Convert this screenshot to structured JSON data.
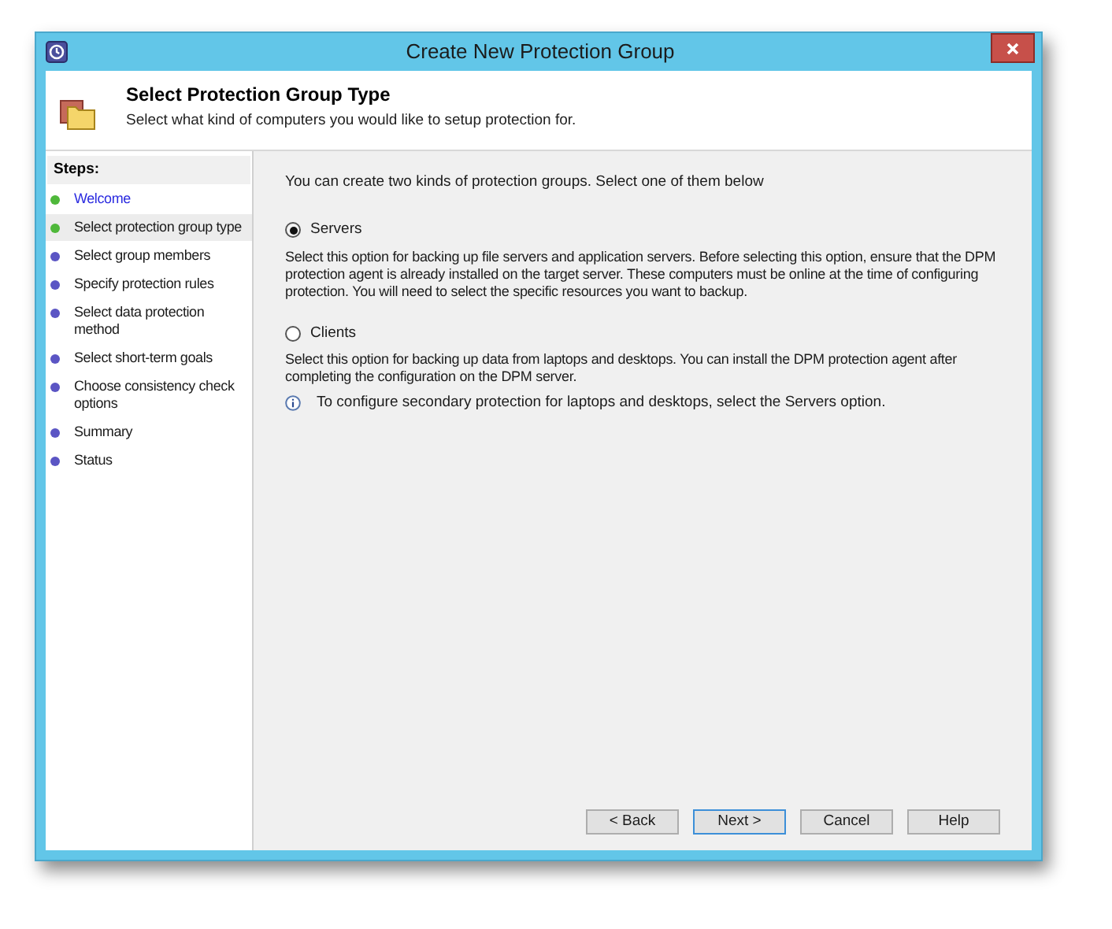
{
  "window": {
    "title": "Create New Protection Group"
  },
  "header": {
    "title": "Select Protection Group Type",
    "subtitle": "Select what kind of computers you would like to setup protection for."
  },
  "steps": {
    "heading": "Steps:",
    "items": [
      {
        "label": "Welcome",
        "completed": true,
        "selected": false
      },
      {
        "label": "Select protection group type",
        "completed": true,
        "selected": true
      },
      {
        "label": "Select group members",
        "completed": false,
        "selected": false
      },
      {
        "label": "Specify protection rules",
        "completed": false,
        "selected": false
      },
      {
        "label": "Select data protection method",
        "completed": false,
        "selected": false
      },
      {
        "label": "Select short-term goals",
        "completed": false,
        "selected": false
      },
      {
        "label": "Choose consistency check options",
        "completed": false,
        "selected": false
      },
      {
        "label": "Summary",
        "completed": false,
        "selected": false
      },
      {
        "label": "Status",
        "completed": false,
        "selected": false
      }
    ]
  },
  "intro": "You can create two kinds of protection groups. Select one of them below",
  "options": [
    {
      "label": "Servers",
      "selected": true,
      "description": "Select this option for backing up file servers and application servers. Before selecting this option, ensure that the DPM protection agent is already installed on the target server. These computers must be online at the time of configuring protection. You will need to select the specific resources you want to backup."
    },
    {
      "label": "Clients",
      "selected": false,
      "description": "Select this option for backing up data from laptops and desktops. You can install the DPM protection agent after completing the configuration on the DPM server.",
      "note": "To configure secondary protection for laptops and desktops, select the Servers option."
    }
  ],
  "buttons": [
    {
      "label": "< Back",
      "default": false
    },
    {
      "label": "Next >",
      "default": true
    },
    {
      "label": "Cancel",
      "default": false
    },
    {
      "label": "Help",
      "default": false
    }
  ]
}
